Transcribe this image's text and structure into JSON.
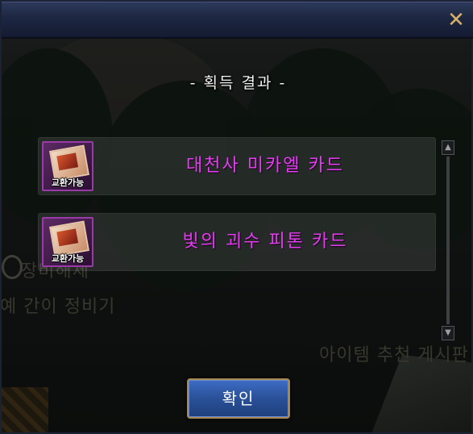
{
  "dialog": {
    "close_icon": "close-icon",
    "heading": "- 획득 결과 -",
    "items": [
      {
        "name": "대천사 미카엘 카드",
        "tag": "교환가능",
        "icon": "card-item-icon",
        "name_color": "#e43cf0"
      },
      {
        "name": "빛의 괴수 피톤 카드",
        "tag": "교환가능",
        "icon": "card-item-icon",
        "name_color": "#e43cf0"
      }
    ],
    "confirm_label": "확인"
  },
  "background": {
    "text_1": "장비해제",
    "text_2": "예 간이 정비기",
    "text_3": "아이템 추천 게시판"
  },
  "colors": {
    "titlebar": "#1d2742",
    "close_icon": "#d8b068",
    "item_name": "#e43cf0",
    "confirm_button": "#2a5198"
  }
}
